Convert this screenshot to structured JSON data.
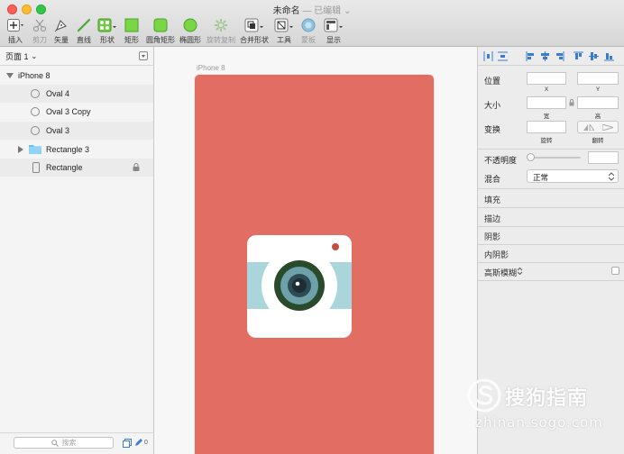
{
  "window": {
    "title": "未命名",
    "subtitle": "— 已编辑",
    "caret": "⌄"
  },
  "toolbar": [
    {
      "label": "插入",
      "icon": "plus-icon",
      "dim": false
    },
    {
      "label": "剪刀",
      "icon": "scissors-icon",
      "dim": true
    },
    {
      "label": "矢量",
      "icon": "pen-icon",
      "dim": false
    },
    {
      "label": "直线",
      "icon": "line-icon",
      "dim": false
    },
    {
      "label": "形状",
      "icon": "shapes-icon",
      "dim": false
    },
    {
      "label": "矩形",
      "icon": "rectangle-icon",
      "dim": false
    },
    {
      "label": "圆角矩形",
      "icon": "rounded-rectangle-icon",
      "dim": false
    },
    {
      "label": "椭圆形",
      "icon": "oval-icon",
      "dim": false
    },
    {
      "label": "旋转复制",
      "icon": "rotate-copies-icon",
      "dim": true
    },
    {
      "label": "合并形状",
      "icon": "combine-shapes-icon",
      "dim": false
    },
    {
      "label": "工具",
      "icon": "tools-icon",
      "dim": false
    },
    {
      "label": "蒙板",
      "icon": "mask-icon",
      "dim": true
    },
    {
      "label": "显示",
      "icon": "view-icon",
      "dim": false
    }
  ],
  "pages": {
    "label": "页面 1",
    "caret": "⌄"
  },
  "layers": [
    {
      "name": "iPhone 8",
      "type": "artboard"
    },
    {
      "name": "Oval 4",
      "type": "oval"
    },
    {
      "name": "Oval 3 Copy",
      "type": "oval"
    },
    {
      "name": "Oval 3",
      "type": "oval"
    },
    {
      "name": "Rectangle 3",
      "type": "folder"
    },
    {
      "name": "Rectangle",
      "type": "rectangle",
      "locked": true
    }
  ],
  "search": {
    "placeholder": "搜索"
  },
  "left_footer": {
    "count": "0"
  },
  "canvas": {
    "artboard_label": "iPhone 8",
    "colors": {
      "artboard": "#e26e63",
      "card": "#ffffff",
      "band": "#a9d5db",
      "lens_outer": "#2a4a2c",
      "lens_ring": "#6da0a8",
      "lens_inner": "#2d4b55",
      "flash": "#c44f3e"
    }
  },
  "inspector": {
    "position": {
      "label": "位置",
      "x": "X",
      "y": "Y"
    },
    "size": {
      "label": "大小",
      "w": "宽",
      "h": "高"
    },
    "transform": {
      "label": "变换",
      "rotate": "旋转",
      "flip": "翻转"
    },
    "opacity": {
      "label": "不透明度"
    },
    "blending": {
      "label": "混合",
      "value": "正常"
    },
    "sections": [
      "填充",
      "描边",
      "阴影",
      "内阴影"
    ],
    "blur": {
      "label": "高斯模糊"
    }
  },
  "watermark": {
    "text": "搜狗指南",
    "url": "zhinan.sogo.com"
  }
}
